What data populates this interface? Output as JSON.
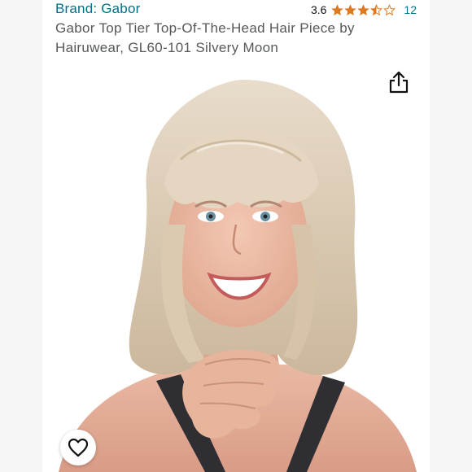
{
  "brand": {
    "label": "Brand: Gabor",
    "link_color": "#007185"
  },
  "rating": {
    "value": "3.6",
    "stars_filled": 3.5,
    "stars_total": 5,
    "star_color": "#de7921",
    "count": "12"
  },
  "product": {
    "title": "Gabor Top Tier Top-Of-The-Head Hair Piece by Hairuwear, GL60-101 Silvery Moon"
  },
  "image": {
    "subject": "product photo of woman wearing silvery blonde wig"
  },
  "actions": {
    "share_icon": "share-icon",
    "favorite_icon": "heart-icon"
  }
}
